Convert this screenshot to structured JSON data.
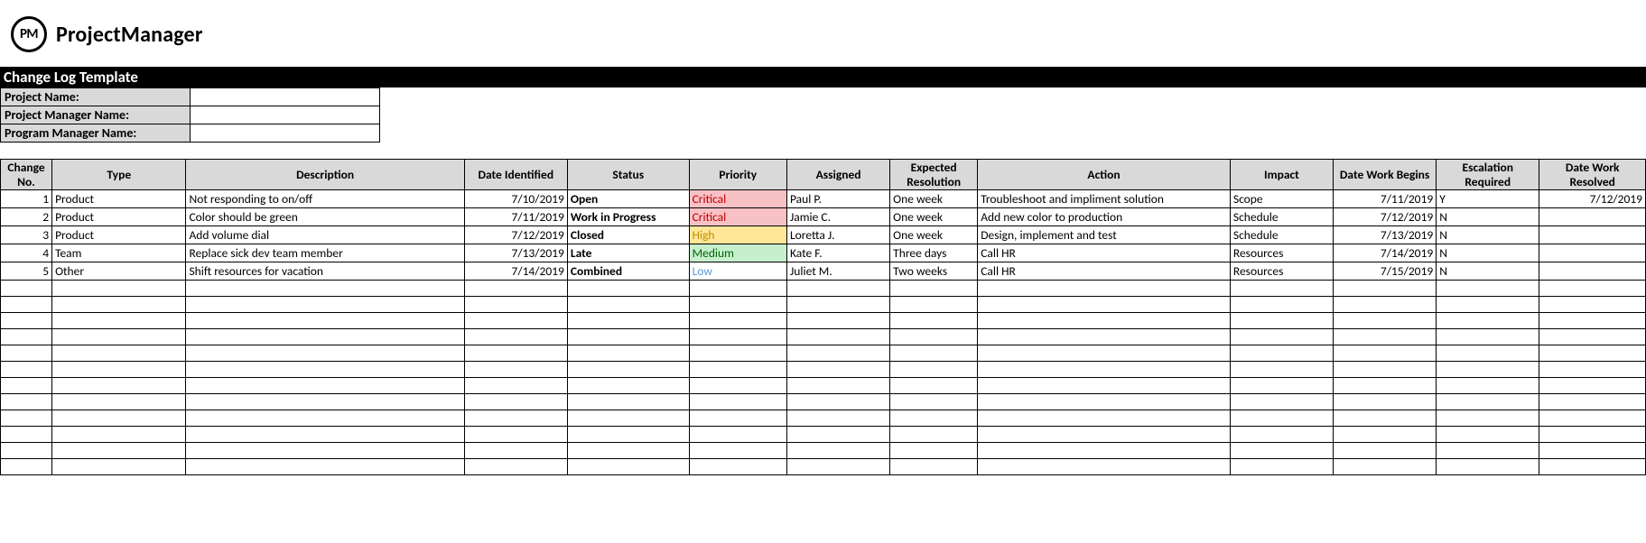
{
  "logo": {
    "badge": "PM",
    "text": "ProjectManager"
  },
  "title": "Change Log Template",
  "meta": {
    "rows": [
      {
        "label": "Project Name:",
        "value": ""
      },
      {
        "label": "Project Manager Name:",
        "value": ""
      },
      {
        "label": "Program Manager Name:",
        "value": ""
      }
    ]
  },
  "columns": [
    "Change No.",
    "Type",
    "Description",
    "Date Identified",
    "Status",
    "Priority",
    "Assigned",
    "Expected Resolution",
    "Action",
    "Impact",
    "Date Work Begins",
    "Escalation Required",
    "Date Work Resolved"
  ],
  "rows": [
    {
      "no": "1",
      "type": "Product",
      "desc": "Not responding to on/off",
      "date_id": "7/10/2019",
      "status": "Open",
      "priority": "Critical",
      "prio_class": "prio-critical",
      "assigned": "Paul P.",
      "exp_res": "One week",
      "action": "Troubleshoot and impliment solution",
      "impact": "Scope",
      "date_wb": "7/11/2019",
      "esc": "Y",
      "date_wr": "7/12/2019"
    },
    {
      "no": "2",
      "type": "Product",
      "desc": "Color should be green",
      "date_id": "7/11/2019",
      "status": "Work in Progress",
      "priority": "Critical",
      "prio_class": "prio-critical",
      "assigned": "Jamie C.",
      "exp_res": "One week",
      "action": "Add new color to production",
      "impact": "Schedule",
      "date_wb": "7/12/2019",
      "esc": "N",
      "date_wr": ""
    },
    {
      "no": "3",
      "type": "Product",
      "desc": "Add volume dial",
      "date_id": "7/12/2019",
      "status": "Closed",
      "priority": "High",
      "prio_class": "prio-high",
      "assigned": "Loretta J.",
      "exp_res": "One week",
      "action": "Design, implement and test",
      "impact": "Schedule",
      "date_wb": "7/13/2019",
      "esc": "N",
      "date_wr": ""
    },
    {
      "no": "4",
      "type": "Team",
      "desc": "Replace sick dev team member",
      "date_id": "7/13/2019",
      "status": "Late",
      "priority": "Medium",
      "prio_class": "prio-medium",
      "assigned": "Kate F.",
      "exp_res": "Three days",
      "action": "Call HR",
      "impact": "Resources",
      "date_wb": "7/14/2019",
      "esc": "N",
      "date_wr": ""
    },
    {
      "no": "5",
      "type": "Other",
      "desc": "Shift resources for vacation",
      "date_id": "7/14/2019",
      "status": "Combined",
      "priority": "Low",
      "prio_class": "prio-low",
      "assigned": "Juliet M.",
      "exp_res": "Two weeks",
      "action": "Call HR",
      "impact": "Resources",
      "date_wb": "7/15/2019",
      "esc": "N",
      "date_wr": ""
    }
  ],
  "empty_row_count": 12
}
